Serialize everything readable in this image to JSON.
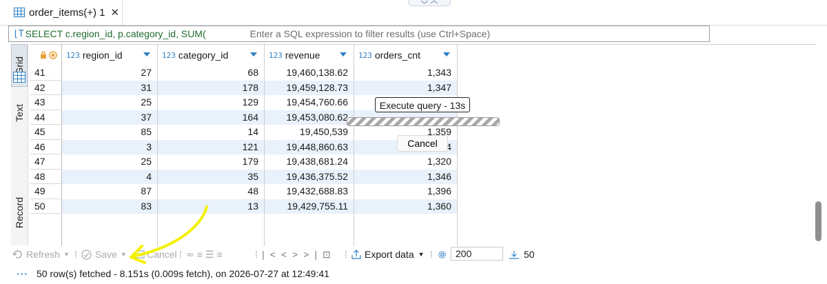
{
  "tab": {
    "title": "order_items(+) 1",
    "close": "✕"
  },
  "filter": {
    "sql_icon": "⌊T",
    "query": "SELECT c.region_id, p.category_id, SUM(",
    "placeholder": "Enter a SQL expression to filter results (use Ctrl+Space)"
  },
  "side_tabs": [
    "Grid",
    "Text",
    "Record"
  ],
  "columns": [
    {
      "type": "123",
      "name": "region_id"
    },
    {
      "type": "123",
      "name": "category_id"
    },
    {
      "type": "123",
      "name": "revenue"
    },
    {
      "type": "123",
      "name": "orders_cnt"
    }
  ],
  "rows": [
    {
      "num": "41",
      "region_id": "27",
      "category_id": "68",
      "revenue": "19,460,138.62",
      "orders_cnt": "1,343"
    },
    {
      "num": "42",
      "region_id": "31",
      "category_id": "178",
      "revenue": "19,459,128.73",
      "orders_cnt": "1,347"
    },
    {
      "num": "43",
      "region_id": "25",
      "category_id": "129",
      "revenue": "19,454,760.66",
      "orders_cnt": ""
    },
    {
      "num": "44",
      "region_id": "37",
      "category_id": "164",
      "revenue": "19,453,080.62",
      "orders_cnt": ""
    },
    {
      "num": "45",
      "region_id": "85",
      "category_id": "14",
      "revenue": "19,450,539",
      "orders_cnt": "1,359"
    },
    {
      "num": "46",
      "region_id": "3",
      "category_id": "121",
      "revenue": "19,448,860.63",
      "orders_cnt": "4"
    },
    {
      "num": "47",
      "region_id": "25",
      "category_id": "179",
      "revenue": "19,438,681.24",
      "orders_cnt": "1,320"
    },
    {
      "num": "48",
      "region_id": "4",
      "category_id": "35",
      "revenue": "19,436,375.52",
      "orders_cnt": "1,346"
    },
    {
      "num": "49",
      "region_id": "87",
      "category_id": "48",
      "revenue": "19,432,688.83",
      "orders_cnt": "1,396"
    },
    {
      "num": "50",
      "region_id": "83",
      "category_id": "13",
      "revenue": "19,429,755.11",
      "orders_cnt": "1,360"
    }
  ],
  "overlay": {
    "execute_label": "Execute query - 13s",
    "cancel_label": "Cancel"
  },
  "toolbar": {
    "refresh": "Refresh",
    "save": "Save",
    "cancel": "Cancel",
    "export": "Export data",
    "fetch_size": "200",
    "fetch_all": "50"
  },
  "status": {
    "text": "50 row(s) fetched - 8.151s (0.009s fetch), on 2026-07-27 at 12:49:41"
  },
  "colors": {
    "accent": "#2c7fc4",
    "sql_green": "#1f6e2e",
    "row_alt": "#e9f1fb",
    "annotation": "#f5f000"
  }
}
